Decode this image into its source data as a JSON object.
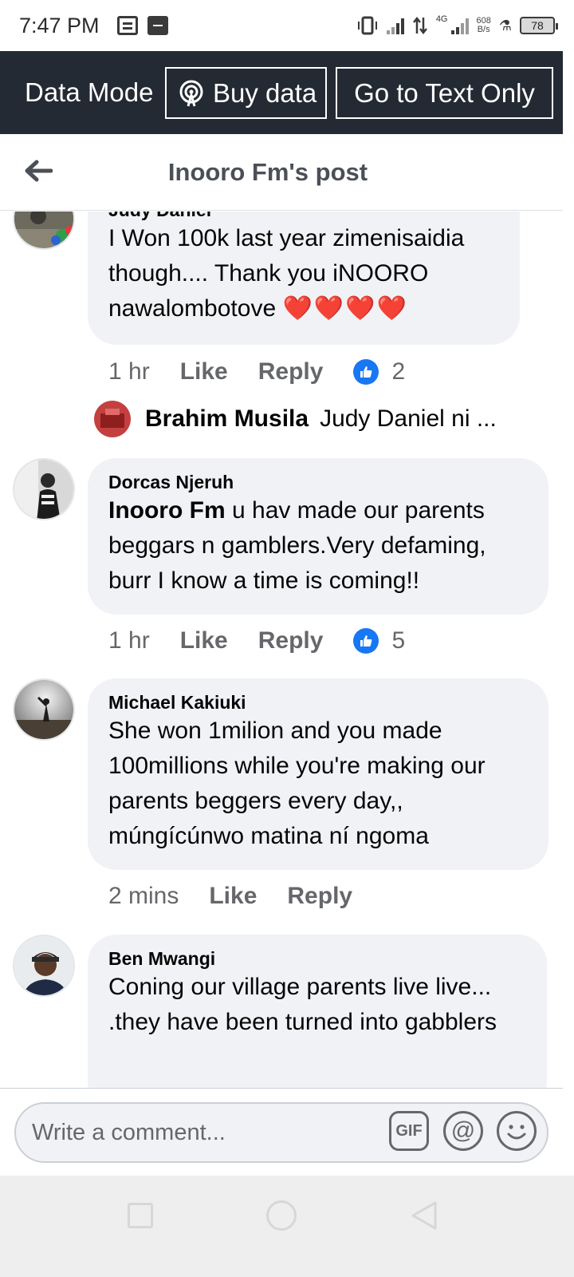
{
  "status_bar": {
    "time": "7:47 PM",
    "network_type": "4G",
    "net_speed_value": "608",
    "net_speed_unit": "B/s",
    "battery": "78"
  },
  "data_bar": {
    "mode_label": "Data Mode",
    "buy_data_label": "Buy data",
    "text_only_label": "Go to Text Only"
  },
  "header": {
    "title": "Inooro Fm's post"
  },
  "comments": [
    {
      "author": "Judy Daniel",
      "text": "I Won 100k last year zimenisaidia though.... Thank you iNOORO nawalombotove",
      "emoji": "❤️❤️❤️❤️",
      "time": "1 hr",
      "like_label": "Like",
      "reply_label": "Reply",
      "like_count": "2",
      "reply_preview": {
        "author": "Brahim Musila",
        "text": "Judy Daniel ni ..."
      }
    },
    {
      "author": "Dorcas Njeruh",
      "mention": "Inooro Fm",
      "text": " u hav made our parents beggars n gamblers.Very defaming, burr I know a time is coming!!",
      "time": "1 hr",
      "like_label": "Like",
      "reply_label": "Reply",
      "like_count": "5"
    },
    {
      "author": "Michael Kakiuki",
      "text": "She won 1milion and you made 100millions while you're making our parents beggers every day,, múngícúnwo matina ní ngoma",
      "time": "2 mins",
      "like_label": "Like",
      "reply_label": "Reply"
    },
    {
      "author": "Ben Mwangi",
      "text": "Coning our village parents live live... .they have been turned into gabblers"
    }
  ],
  "composer": {
    "placeholder": "Write a comment...",
    "gif_label": "GIF",
    "at_label": "@"
  },
  "colors": {
    "data_bar_bg": "#242a33",
    "bubble_bg": "#f0f2f5",
    "like_blue": "#1877f2",
    "meta_gray": "#65676b"
  }
}
